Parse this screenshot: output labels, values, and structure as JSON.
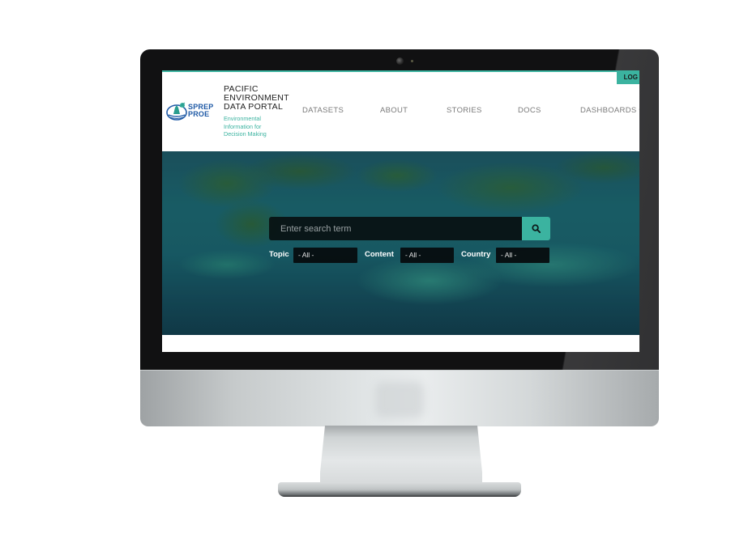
{
  "site": {
    "title_lines": [
      "PACIFIC",
      "ENVIRONMENT",
      "DATA PORTAL"
    ],
    "subtitle_lines": [
      "Environmental",
      "Information for",
      "Decision Making"
    ],
    "logo_text_lines": [
      "SPREP",
      "PROE"
    ]
  },
  "header": {
    "login_label": "LOG",
    "nav": [
      {
        "label": "DATASETS"
      },
      {
        "label": "ABOUT"
      },
      {
        "label": "STORIES"
      },
      {
        "label": "DOCS"
      },
      {
        "label": "DASHBOARDS"
      }
    ],
    "dropdown_caret": "▾"
  },
  "hero": {
    "search_placeholder": "Enter search term",
    "search_icon": "search-icon",
    "filters": [
      {
        "label": "Topic",
        "value": "- All -"
      },
      {
        "label": "Content",
        "value": "- All -"
      },
      {
        "label": "Country",
        "value": "- All -"
      }
    ]
  },
  "colors": {
    "accent": "#3bb3a0",
    "logo_blue": "#1f5aa6",
    "nav_text": "#7a7a7a"
  }
}
